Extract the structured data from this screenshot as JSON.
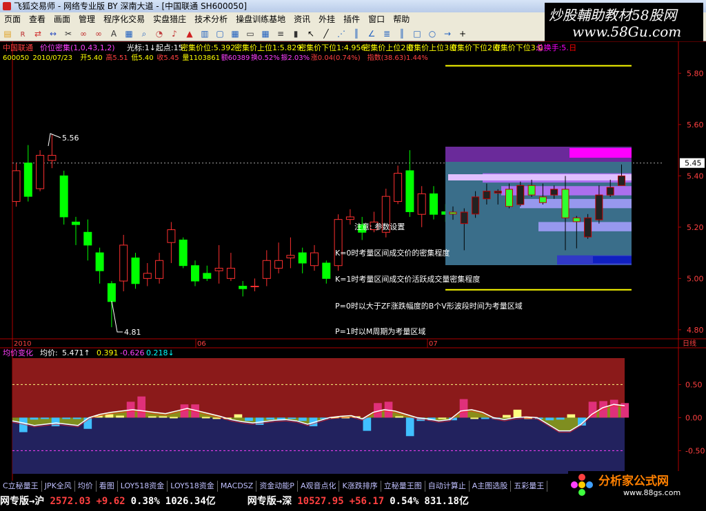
{
  "window": {
    "title": "飞狐交易师 - 网络专业版 BY 深南大道 - [中国联通 SH600050]"
  },
  "menu": [
    "页面",
    "查看",
    "画面",
    "管理",
    "程序化交易",
    "实盘猎庄",
    "技术分析",
    "操盘训练基地",
    "资讯",
    "外挂",
    "插件",
    "窗口",
    "帮助"
  ],
  "toolbar_icons": [
    "folder-icon",
    "rsi-icon",
    "arrow-icon",
    "swap-icon",
    "knife-icon",
    "glasses-icon",
    "glasses2-icon",
    "text-icon",
    "grid-icon",
    "search-icon",
    "pie-icon",
    "bell-icon",
    "warning-icon",
    "chart-icon",
    "window-icon",
    "table-icon",
    "frame-icon",
    "grid2-icon",
    "list-icon",
    "k-icon",
    "cursor-icon",
    "pen-icon",
    "fan-icon",
    "bars-icon",
    "angle-icon",
    "lines-icon",
    "bars2-icon",
    "rect-icon",
    "circle-icon",
    "arrow-right-icon",
    "plus-icon"
  ],
  "watermark": {
    "line1": "炒股輔助教材58股网",
    "line2": "www.58Gu.com"
  },
  "main_chart": {
    "header": {
      "stock_name": "中国联通",
      "indicator": "价位密集(1,0,43,1,2)",
      "items": [
        {
          "text": "光标:1↓起点:15",
          "color": "#ffffff"
        },
        {
          "text": "密集价位:5.392",
          "color": "#ffff00"
        },
        {
          "text": "密集价上位1:5.829",
          "color": "#ffff00"
        },
        {
          "text": "密集价下位1:4.956",
          "color": "#ffff00"
        },
        {
          "text": "密集价上位2:0",
          "color": "#ffff00"
        },
        {
          "text": "密集价上位3:0",
          "color": "#ffff00"
        },
        {
          "text": "密集价下位2:0",
          "color": "#ffff00"
        },
        {
          "text": "密集价下位3:0",
          "color": "#ffff00"
        },
        {
          "text": "总换手:5.",
          "color": "#ff00ff"
        },
        {
          "text": "日",
          "color": "#ff0000"
        }
      ]
    },
    "quote": {
      "code": "600050",
      "date": "2010/07/23",
      "open": "开5.40",
      "high": "高5.51",
      "low": "低5.40",
      "close": "收5.45",
      "volume": "量1103861",
      "amount": "额60389",
      "turnover": "换0.52%",
      "amplitude": "振2.03%",
      "change": "涨0.04(0.74%)",
      "index": "指数(38.63)1.44%"
    },
    "y_axis": [
      "5.80",
      "5.60",
      "5.40",
      "5.20",
      "5.00",
      "4.80"
    ],
    "current_price": "5.45",
    "high_label": "5.56",
    "low_label": "4.81",
    "x_labels": [
      "2010",
      "06",
      "07"
    ],
    "period": "日线",
    "param_panel": {
      "title": "注意: 参数设置",
      "lines": [
        "K=0时考量区间成交价的密集程度",
        "K=1时考量区间成交价活跃成交量密集程度",
        "P=0时以大于ZF涨跌幅度的B个V形波段时间为考量区域",
        "P=1时以M周期为考量区域"
      ]
    },
    "candles": [
      [
        5.3,
        5.42,
        5.45,
        5.28
      ],
      [
        5.45,
        5.32,
        5.52,
        5.3
      ],
      [
        5.35,
        5.48,
        5.5,
        5.34
      ],
      [
        5.46,
        5.48,
        5.56,
        5.43
      ],
      [
        5.4,
        5.24,
        5.42,
        5.21
      ],
      [
        5.22,
        5.21,
        5.24,
        5.13
      ],
      [
        5.18,
        5.13,
        5.23,
        5.07
      ],
      [
        5.1,
        5.03,
        5.12,
        4.98
      ],
      [
        4.98,
        4.91,
        4.99,
        4.81
      ],
      [
        4.99,
        5.13,
        5.17,
        4.95
      ],
      [
        5.08,
        4.98,
        5.1,
        4.96
      ],
      [
        5.0,
        5.02,
        5.06,
        4.97
      ],
      [
        5.0,
        5.07,
        5.1,
        4.98
      ],
      [
        5.14,
        5.19,
        5.22,
        5.06
      ],
      [
        5.15,
        5.05,
        5.16,
        5.04
      ],
      [
        5.05,
        4.99,
        5.07,
        4.97
      ],
      [
        5.02,
        5.0,
        5.05,
        4.99
      ],
      [
        5.03,
        5.04,
        5.13,
        4.98
      ],
      [
        5.0,
        5.04,
        5.1,
        4.99
      ],
      [
        4.97,
        4.96,
        4.99,
        4.93
      ],
      [
        4.97,
        4.97,
        5.0,
        4.95
      ],
      [
        5.0,
        5.07,
        5.11,
        4.97
      ],
      [
        5.04,
        5.07,
        5.14,
        5.02
      ],
      [
        5.08,
        5.09,
        5.16,
        5.04
      ],
      [
        5.1,
        5.06,
        5.12,
        5.02
      ],
      [
        5.05,
        5.1,
        5.13,
        5.03
      ],
      [
        5.06,
        5.0,
        5.07,
        4.98
      ],
      [
        5.05,
        5.23,
        5.25,
        5.03
      ],
      [
        5.23,
        5.24,
        5.27,
        5.21
      ],
      [
        5.21,
        5.18,
        5.24,
        5.15
      ],
      [
        5.19,
        5.22,
        5.26,
        5.18
      ],
      [
        5.18,
        5.32,
        5.35,
        5.16
      ],
      [
        5.3,
        5.41,
        5.44,
        5.29
      ],
      [
        5.42,
        5.26,
        5.5,
        5.24
      ],
      [
        5.25,
        5.33,
        5.36,
        5.2
      ],
      [
        5.33,
        5.25,
        5.36,
        5.23
      ],
      [
        5.26,
        5.25,
        5.29,
        5.22
      ],
      [
        5.2,
        5.26,
        5.28,
        5.06
      ],
      [
        5.25,
        5.34,
        5.37,
        5.23
      ],
      [
        5.33,
        5.37,
        5.41,
        5.3
      ],
      [
        5.36,
        5.37,
        5.38,
        5.3
      ],
      [
        5.38,
        5.29,
        5.41,
        5.28
      ],
      [
        5.3,
        5.4,
        5.42,
        5.29
      ],
      [
        5.4,
        5.35,
        5.43,
        5.34
      ],
      [
        5.34,
        5.31,
        5.41,
        5.3
      ],
      [
        5.35,
        5.38,
        5.4,
        5.33
      ],
      [
        5.38,
        5.23,
        5.45,
        5.06
      ],
      [
        5.23,
        5.21,
        5.24,
        5.07
      ],
      [
        5.13,
        5.23,
        5.25,
        5.12
      ],
      [
        5.22,
        5.35,
        5.4,
        5.2
      ],
      [
        5.35,
        5.39,
        5.43,
        5.34
      ],
      [
        5.4,
        5.45,
        5.51,
        5.4
      ]
    ],
    "bands": [
      {
        "lo": 5.34,
        "hi": 5.36,
        "len": 0.7,
        "color": "#c070ff"
      },
      {
        "lo": 5.39,
        "hi": 5.41,
        "len": 0.8,
        "color": "#c070ff"
      },
      {
        "lo": 5.29,
        "hi": 5.31,
        "len": 0.6,
        "color": "#a8a0ff"
      },
      {
        "lo": 5.2,
        "hi": 5.22,
        "len": 0.5,
        "color": "#a8a0ff"
      },
      {
        "lo": 5.07,
        "hi": 5.09,
        "len": 0.4,
        "color": "#3030d0"
      }
    ]
  },
  "sub_chart": {
    "header": {
      "name": "均价变化",
      "label": "均价:",
      "value": "5.471↑",
      "v2": "0.391",
      "v3": "-0.626",
      "v4": "0.218↓"
    },
    "y_axis": [
      "0.50",
      "0.00",
      "-0.50"
    ],
    "bars": [
      -0.22,
      -0.03,
      -0.02,
      -0.13,
      -0.02,
      -0.02,
      -0.17,
      0.03,
      0.05,
      0.03,
      0.24,
      0.32,
      0.02,
      0.02,
      0.01,
      0.2,
      0.2,
      0.01,
      0.0,
      0.0,
      0.05,
      -0.05,
      -0.11,
      -0.03,
      -0.04,
      -0.01,
      -0.05,
      -0.13,
      -0.01,
      0.01,
      0.01,
      0.02,
      -0.2,
      0.22,
      0.24,
      0.02,
      -0.28,
      -0.05,
      -0.04,
      0.0,
      -0.04,
      0.28,
      0.0,
      -0.01,
      -0.02,
      0.04,
      0.12,
      0.0,
      -0.01,
      -0.04,
      -0.03,
      0.05,
      -0.12,
      0.24,
      0.25,
      0.27,
      0.22
    ],
    "line": [
      -0.05,
      -0.08,
      -0.12,
      -0.1,
      -0.08,
      -0.1,
      -0.12,
      0.0,
      0.05,
      0.08,
      0.1,
      0.12,
      0.1,
      0.08,
      0.06,
      0.1,
      0.14,
      0.1,
      0.06,
      0.02,
      -0.03,
      -0.06,
      -0.08,
      -0.06,
      -0.04,
      -0.03,
      -0.05,
      -0.1,
      -0.05,
      0.0,
      0.02,
      0.03,
      -0.02,
      0.08,
      0.12,
      0.1,
      0.05,
      0.0,
      -0.02,
      -0.05,
      -0.03,
      0.1,
      0.12,
      0.08,
      0.0,
      -0.03,
      0.0,
      0.01,
      0.0,
      -0.1,
      -0.2,
      -0.2,
      -0.1,
      0.05,
      0.15,
      0.2,
      0.18
    ]
  },
  "tabs": [
    "C立秘量王",
    "JPK全风",
    "均价",
    "看图",
    "LOY518资金",
    "LOY518资金",
    "MACDSZ",
    "资金动能P",
    "A观音点化",
    "K涨跌排序",
    "立秘量王图",
    "自动计算止",
    "A主图选股",
    "五彩量王"
  ],
  "index_bar": [
    {
      "label": "网专版→沪",
      "color": "#ffffff"
    },
    {
      "label": "2572.03",
      "color": "#ff4040"
    },
    {
      "label": "+9.62",
      "color": "#ff4040"
    },
    {
      "label": "0.38%",
      "color": "#ffffff"
    },
    {
      "label": "1026.34亿",
      "color": "#ffffff"
    },
    {
      "label": "网专版→深",
      "color": "#ffffff"
    },
    {
      "label": "10527.95",
      "color": "#ff4040"
    },
    {
      "label": "+56.17",
      "color": "#ff4040"
    },
    {
      "label": "0.54%",
      "color": "#ffffff"
    },
    {
      "label": "831.18亿",
      "color": "#ffffff"
    }
  ],
  "logo2": {
    "text": "分析家公式网",
    "url": "www.88gs.com"
  },
  "colors": {
    "up": "#ff3030",
    "down": "#00ff00",
    "bg": "#000000",
    "axis": "#b00000",
    "sub_top": "#8b1a1a",
    "sub_bottom": "#22225e"
  }
}
